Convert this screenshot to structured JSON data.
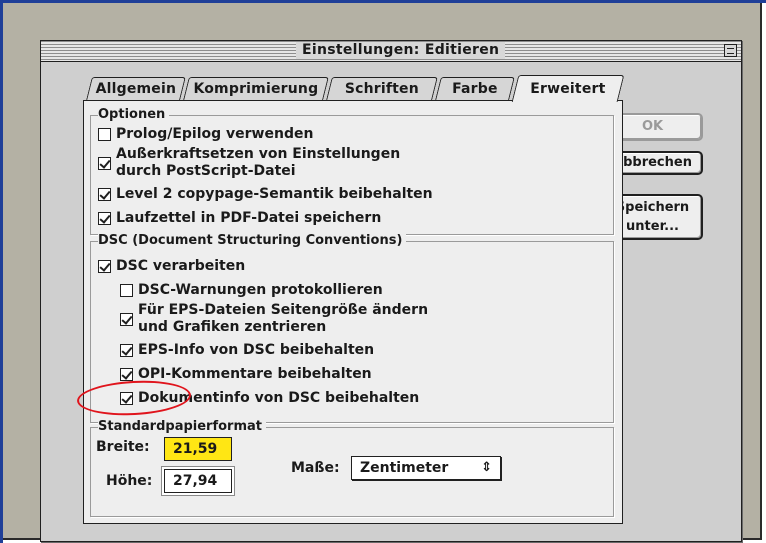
{
  "window": {
    "title": "Einstellungen: Editieren"
  },
  "tabs": [
    {
      "label": "Allgemein"
    },
    {
      "label": "Komprimierung"
    },
    {
      "label": "Schriften"
    },
    {
      "label": "Farbe"
    },
    {
      "label": "Erweitert",
      "active": true
    }
  ],
  "options": {
    "title": "Optionen",
    "items": [
      {
        "label": "Prolog/Epilog verwenden",
        "checked": false
      },
      {
        "label": "Außerkraftsetzen von Einstellungen",
        "label2": "durch PostScript-Datei",
        "checked": true
      },
      {
        "label": "Level 2 copypage-Semantik beibehalten",
        "checked": true
      },
      {
        "label": "Laufzettel in PDF-Datei speichern",
        "checked": true
      }
    ]
  },
  "dsc": {
    "title": "DSC (Document Structuring Conventions)",
    "items": [
      {
        "label": "DSC verarbeiten",
        "checked": true
      },
      {
        "label": "DSC-Warnungen protokollieren",
        "checked": false
      },
      {
        "label": "Für EPS-Dateien Seitengröße ändern",
        "label2": "und Grafiken zentrieren",
        "checked": true
      },
      {
        "label": "EPS-Info von DSC beibehalten",
        "checked": true
      },
      {
        "label": "OPI-Kommentare beibehalten",
        "checked": true
      },
      {
        "label": "Dokumentinfo von DSC beibehalten",
        "checked": true
      }
    ]
  },
  "paper": {
    "title": "Standardpapierformat",
    "width_label": "Breite:",
    "width_value": "21,59",
    "height_label": "Höhe:",
    "height_value": "27,94",
    "units_label": "Maße:",
    "units_value": "Zentimeter"
  },
  "buttons": {
    "ok": "OK",
    "cancel": "Abbrechen",
    "save_as_line1": "Speichern",
    "save_as_line2": "unter..."
  },
  "colors": {
    "highlight_field": "#ffe614",
    "annotation": "#e0141c",
    "window_bg": "#cfcfcf",
    "panel_bg": "#eeeeee"
  }
}
